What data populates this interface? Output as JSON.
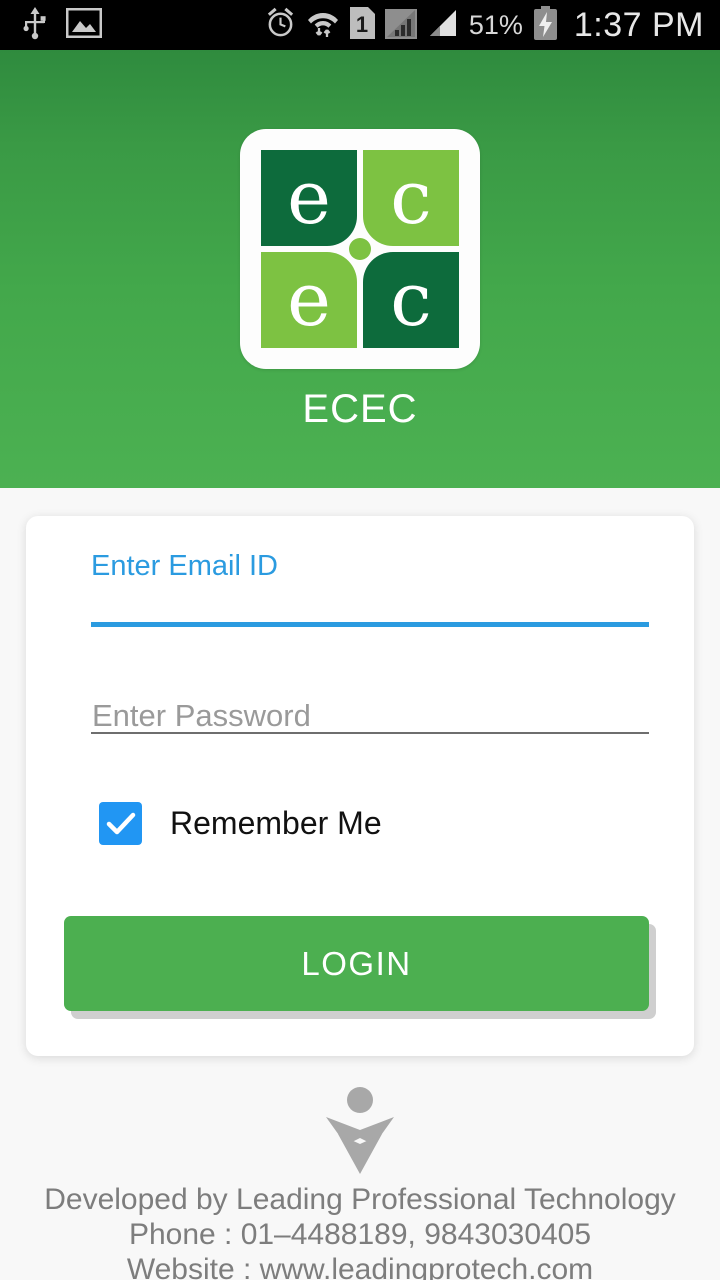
{
  "status_bar": {
    "left_icons": [
      "usb-icon",
      "screenshot-image-icon"
    ],
    "right_icons": [
      "alarm-icon",
      "wifi-transfer-icon",
      "sim1-icon",
      "signal-1-icon",
      "signal-2-icon",
      "battery-charging-icon"
    ],
    "battery_percent": "51%",
    "time": "1:37 PM"
  },
  "header": {
    "app_title": "ECEC",
    "logo": {
      "quadrants": [
        {
          "letter": "e",
          "color": "#0d6b3c"
        },
        {
          "letter": "c",
          "color": "#7dc242"
        },
        {
          "letter": "e",
          "color": "#7dc242"
        },
        {
          "letter": "c",
          "color": "#0d6b3c"
        }
      ],
      "center_dot_color": "#7dc242"
    },
    "background_color_top": "#2f8b3e",
    "background_color_bottom": "#4cb152"
  },
  "login_form": {
    "email": {
      "label": "Enter Email ID",
      "value": "",
      "placeholder": "Enter Email ID",
      "focused": true,
      "accent_color": "#2b9be0"
    },
    "password": {
      "value": "",
      "placeholder": "Enter Password",
      "focused": false,
      "line_color": "#6e6e6e"
    },
    "remember_me": {
      "label": "Remember Me",
      "checked": true,
      "color": "#2196f3"
    },
    "login_button": {
      "label": "LOGIN",
      "color": "#4caf50"
    }
  },
  "footer": {
    "logo_icon": "leading-protech-person-icon",
    "line1": "Developed by Leading Professional Technology",
    "line2": "Phone : 01–4488189, 9843030405",
    "line3": "Website : www.leadingprotech.com",
    "text_color": "#7d7d7d"
  }
}
